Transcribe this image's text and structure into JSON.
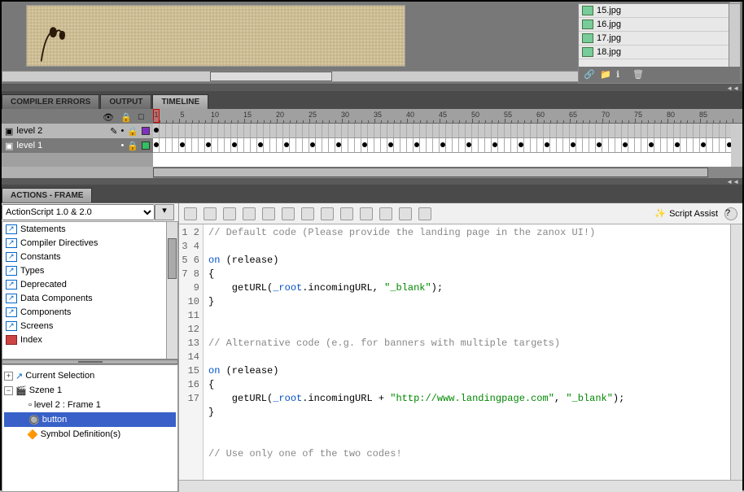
{
  "library": {
    "items": [
      "15.jpg",
      "16.jpg",
      "17.jpg",
      "18.jpg"
    ]
  },
  "tabs": {
    "compiler_errors": "COMPILER ERRORS",
    "output": "OUTPUT",
    "timeline": "TIMELINE"
  },
  "timeline": {
    "ticks": [
      1,
      5,
      10,
      15,
      20,
      25,
      30,
      35,
      40,
      45,
      50,
      55,
      60,
      65,
      70,
      75,
      80,
      85
    ],
    "layers": [
      {
        "name": "level 2",
        "color": "#8030c0"
      },
      {
        "name": "level 1",
        "color": "#30c060"
      }
    ]
  },
  "actions_tab": "ACTIONS - FRAME",
  "as_version": "ActionScript 1.0 & 2.0",
  "categories": [
    "Statements",
    "Compiler Directives",
    "Constants",
    "Types",
    "Deprecated",
    "Data Components",
    "Components",
    "Screens",
    "Index"
  ],
  "tree": {
    "current_selection": "Current Selection",
    "scene": "Szene 1",
    "frame_item": "level 2 : Frame 1",
    "button_item": "button",
    "symbol_defs": "Symbol Definition(s)"
  },
  "toolbar": {
    "script_assist": "Script Assist"
  },
  "code": {
    "l1": "// Default code (Please provide the landing page in the zanox UI!)",
    "l2": "",
    "l3a": "on",
    "l3b": " (release)",
    "l4": "{",
    "l5a": "    getURL(",
    "l5b": "_root",
    "l5c": ".incomingURL, ",
    "l5d": "\"_blank\"",
    "l5e": ");",
    "l6": "}",
    "l7": "",
    "l8": "",
    "l9": "// Alternative code (e.g. for banners with multiple targets)",
    "l10": "",
    "l11a": "on",
    "l11b": " (release)",
    "l12": "{",
    "l13a": "    getURL(",
    "l13b": "_root",
    "l13c": ".incomingURL + ",
    "l13d": "\"http://www.landingpage.com\"",
    "l13e": ", ",
    "l13f": "\"_blank\"",
    "l13g": ");",
    "l14": "}",
    "l15": "",
    "l16": "",
    "l17": "// Use only one of the two codes!"
  },
  "line_numbers": [
    1,
    2,
    3,
    4,
    5,
    6,
    7,
    8,
    9,
    10,
    11,
    12,
    13,
    14,
    15,
    16,
    17
  ]
}
